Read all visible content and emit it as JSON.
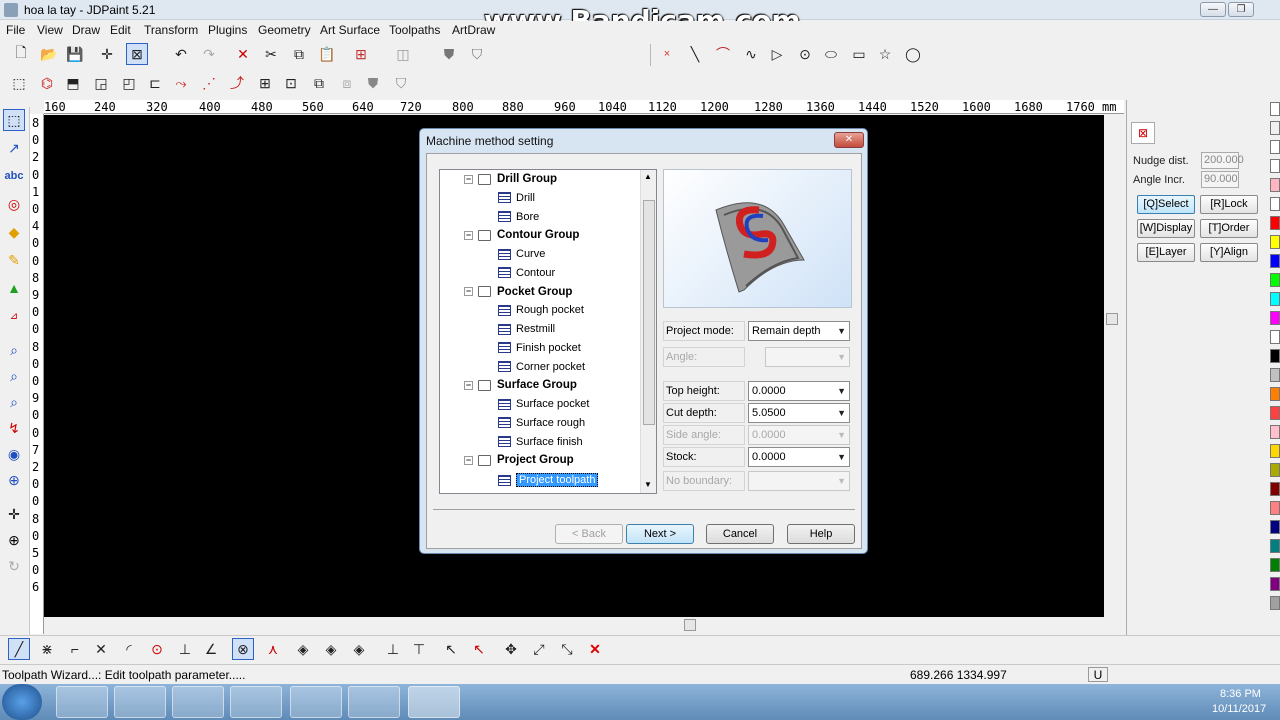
{
  "window": {
    "title": "hoa la tay - JDPaint 5.21",
    "minimize": "—",
    "restore": "❐",
    "close": "✕"
  },
  "watermark": "www.Bandicam.com",
  "menu": [
    "File",
    "View",
    "Draw",
    "Edit",
    "Transform",
    "Plugins",
    "Geometry",
    "Art Surface",
    "Toolpaths",
    "ArtDraw"
  ],
  "ruler": {
    "h_ticks": [
      "160",
      "240",
      "320",
      "400",
      "480",
      "560",
      "640",
      "720",
      "800",
      "880",
      "960",
      "1040",
      "1120",
      "1200",
      "1280",
      "1360",
      "1440",
      "1520",
      "1600",
      "1680",
      "1760",
      "mm"
    ],
    "v_digits": [
      "8",
      "0",
      "2",
      "0",
      "1",
      "0",
      "4",
      "0",
      "0",
      "8",
      "9",
      "0",
      "0",
      "8",
      "0",
      "0",
      "9",
      "0",
      "0",
      "7",
      "2",
      "0",
      "0",
      "8",
      "0",
      "5",
      "0",
      "6"
    ]
  },
  "right_panel": {
    "nudge_label": "Nudge dist.",
    "nudge_value": "200.000",
    "angle_label": "Angle Incr.",
    "angle_value": "90.000",
    "buttons": [
      "[Q]Select",
      "[R]Lock",
      "[W]Display",
      "[T]Order",
      "[E]Layer",
      "[Y]Align"
    ]
  },
  "palette": [
    "#ffffff",
    "#f0f0f0",
    "#ffffff",
    "#ffffff",
    "#ffb6c1",
    "#ffffff",
    "#ff0000",
    "#ffff00",
    "#0000ff",
    "#00ff00",
    "#00ffff",
    "#ff00ff",
    "#ffffff",
    "#000000",
    "#c0c0c0",
    "#ff8000",
    "#ff4040",
    "#ffc0cb",
    "#ffd700",
    "#aaaa00",
    "#800000",
    "#ff8080",
    "#000080",
    "#008080",
    "#008000",
    "#800080",
    "#a0a0a0"
  ],
  "status": {
    "message": "Toolpath Wizard...: Edit toolpath parameter.....",
    "coords": "689.266 1334.997",
    "mode": "U"
  },
  "clock": {
    "time": "8:36 PM",
    "date": "10/11/2017"
  },
  "dialog": {
    "title": "Machine method setting",
    "tree": [
      {
        "label": "Drill Group",
        "group": true
      },
      {
        "label": "Drill"
      },
      {
        "label": "Bore"
      },
      {
        "label": "Contour Group",
        "group": true
      },
      {
        "label": "Curve"
      },
      {
        "label": "Contour"
      },
      {
        "label": "Pocket Group",
        "group": true
      },
      {
        "label": "Rough pocket"
      },
      {
        "label": "Restmill"
      },
      {
        "label": "Finish pocket"
      },
      {
        "label": "Corner pocket"
      },
      {
        "label": "Surface Group",
        "group": true
      },
      {
        "label": "Surface pocket"
      },
      {
        "label": "Surface rough"
      },
      {
        "label": "Surface finish"
      },
      {
        "label": "Project Group",
        "group": true
      },
      {
        "label": "Project toolpath",
        "selected": true
      }
    ],
    "fields": {
      "project_mode": {
        "label": "Project mode:",
        "value": "Remain depth"
      },
      "angle": {
        "label": "Angle:",
        "value": ""
      },
      "top_height": {
        "label": "Top height:",
        "value": "0.0000"
      },
      "cut_depth": {
        "label": "Cut depth:",
        "value": "5.0500"
      },
      "side_angle": {
        "label": "Side angle:",
        "value": "0.0000"
      },
      "stock": {
        "label": "Stock:",
        "value": "0.0000"
      },
      "boundary": {
        "label": "No boundary:",
        "value": ""
      }
    },
    "buttons": {
      "back": "< Back",
      "next": "Next >",
      "cancel": "Cancel",
      "help": "Help"
    }
  }
}
